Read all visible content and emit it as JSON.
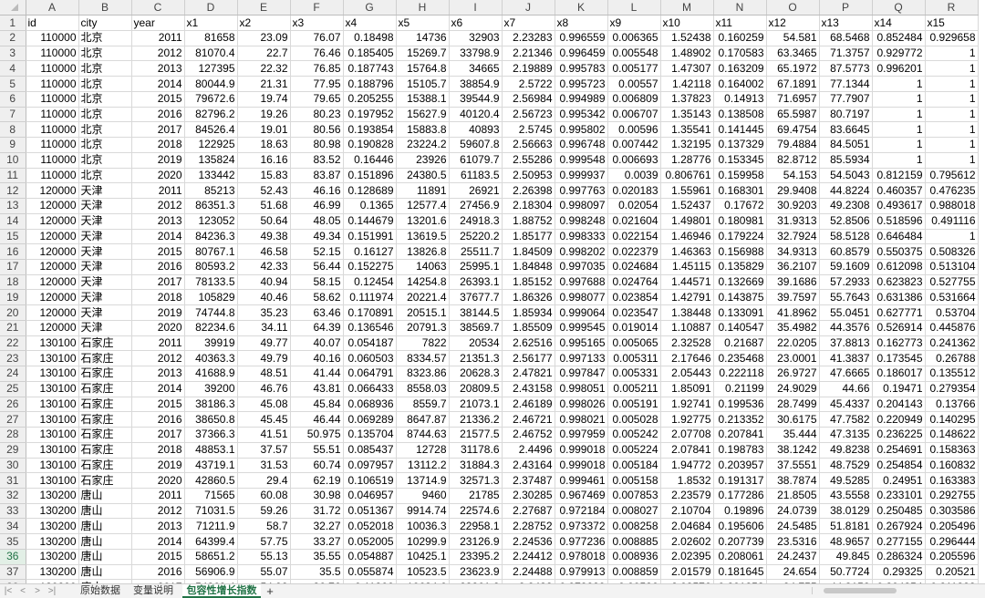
{
  "columns": [
    "A",
    "B",
    "C",
    "D",
    "E",
    "F",
    "G",
    "H",
    "I",
    "J",
    "K",
    "L",
    "M",
    "N",
    "O",
    "P",
    "Q",
    "R"
  ],
  "header_row": [
    "id",
    "city",
    "year",
    "x1",
    "x2",
    "x3",
    "x4",
    "x5",
    "x6",
    "x7",
    "x8",
    "x9",
    "x10",
    "x11",
    "x12",
    "x13",
    "x14",
    "x15"
  ],
  "rows": [
    [
      "110000",
      "北京",
      "2011",
      "81658",
      "23.09",
      "76.07",
      "0.18498",
      "14736",
      "32903",
      "2.23283",
      "0.996559",
      "0.006365",
      "1.52438",
      "0.160259",
      "54.581",
      "68.5468",
      "0.852484",
      "0.929658"
    ],
    [
      "110000",
      "北京",
      "2012",
      "81070.4",
      "22.7",
      "76.46",
      "0.185405",
      "15269.7",
      "33798.9",
      "2.21346",
      "0.996459",
      "0.005548",
      "1.48902",
      "0.170583",
      "63.3465",
      "71.3757",
      "0.929772",
      "1"
    ],
    [
      "110000",
      "北京",
      "2013",
      "127395",
      "22.32",
      "76.85",
      "0.187743",
      "15764.8",
      "34665",
      "2.19889",
      "0.995783",
      "0.005177",
      "1.47307",
      "0.163209",
      "65.1972",
      "87.5773",
      "0.996201",
      "1"
    ],
    [
      "110000",
      "北京",
      "2014",
      "80044.9",
      "21.31",
      "77.95",
      "0.188796",
      "15105.7",
      "38854.9",
      "2.5722",
      "0.995723",
      "0.00557",
      "1.42118",
      "0.164002",
      "67.1891",
      "77.1344",
      "1",
      "1"
    ],
    [
      "110000",
      "北京",
      "2015",
      "79672.6",
      "19.74",
      "79.65",
      "0.205255",
      "15388.1",
      "39544.9",
      "2.56984",
      "0.994989",
      "0.006809",
      "1.37823",
      "0.14913",
      "71.6957",
      "77.7907",
      "1",
      "1"
    ],
    [
      "110000",
      "北京",
      "2016",
      "82796.2",
      "19.26",
      "80.23",
      "0.197952",
      "15627.9",
      "40120.4",
      "2.56723",
      "0.995342",
      "0.006707",
      "1.35143",
      "0.138508",
      "65.5987",
      "80.7197",
      "1",
      "1"
    ],
    [
      "110000",
      "北京",
      "2017",
      "84526.4",
      "19.01",
      "80.56",
      "0.193854",
      "15883.8",
      "40893",
      "2.5745",
      "0.995802",
      "0.00596",
      "1.35541",
      "0.141445",
      "69.4754",
      "83.6645",
      "1",
      "1"
    ],
    [
      "110000",
      "北京",
      "2018",
      "122925",
      "18.63",
      "80.98",
      "0.190828",
      "23224.2",
      "59607.8",
      "2.56663",
      "0.996748",
      "0.007442",
      "1.32195",
      "0.137329",
      "79.4884",
      "84.5051",
      "1",
      "1"
    ],
    [
      "110000",
      "北京",
      "2019",
      "135824",
      "16.16",
      "83.52",
      "0.16446",
      "23926",
      "61079.7",
      "2.55286",
      "0.999548",
      "0.006693",
      "1.28776",
      "0.153345",
      "82.8712",
      "85.5934",
      "1",
      "1"
    ],
    [
      "110000",
      "北京",
      "2020",
      "133442",
      "15.83",
      "83.87",
      "0.151896",
      "24380.5",
      "61183.5",
      "2.50953",
      "0.999937",
      "0.0039",
      "0.806761",
      "0.159958",
      "54.153",
      "54.5043",
      "0.812159",
      "0.795612"
    ],
    [
      "120000",
      "天津",
      "2011",
      "85213",
      "52.43",
      "46.16",
      "0.128689",
      "11891",
      "26921",
      "2.26398",
      "0.997763",
      "0.020183",
      "1.55961",
      "0.168301",
      "29.9408",
      "44.8224",
      "0.460357",
      "0.476235"
    ],
    [
      "120000",
      "天津",
      "2012",
      "86351.3",
      "51.68",
      "46.99",
      "0.1365",
      "12577.4",
      "27456.9",
      "2.18304",
      "0.998097",
      "0.02054",
      "1.52437",
      "0.17672",
      "30.9203",
      "49.2308",
      "0.493617",
      "0.988018"
    ],
    [
      "120000",
      "天津",
      "2013",
      "123052",
      "50.64",
      "48.05",
      "0.144679",
      "13201.6",
      "24918.3",
      "1.88752",
      "0.998248",
      "0.021604",
      "1.49801",
      "0.180981",
      "31.9313",
      "52.8506",
      "0.518596",
      "0.491116"
    ],
    [
      "120000",
      "天津",
      "2014",
      "84236.3",
      "49.38",
      "49.34",
      "0.151991",
      "13619.5",
      "25220.2",
      "1.85177",
      "0.998333",
      "0.022154",
      "1.46946",
      "0.179224",
      "32.7924",
      "58.5128",
      "0.646484",
      "1"
    ],
    [
      "120000",
      "天津",
      "2015",
      "80767.1",
      "46.58",
      "52.15",
      "0.16127",
      "13826.8",
      "25511.7",
      "1.84509",
      "0.998202",
      "0.022379",
      "1.46363",
      "0.156988",
      "34.9313",
      "60.8579",
      "0.550375",
      "0.508326"
    ],
    [
      "120000",
      "天津",
      "2016",
      "80593.2",
      "42.33",
      "56.44",
      "0.152275",
      "14063",
      "25995.1",
      "1.84848",
      "0.997035",
      "0.024684",
      "1.45115",
      "0.135829",
      "36.2107",
      "59.1609",
      "0.612098",
      "0.513104"
    ],
    [
      "120000",
      "天津",
      "2017",
      "78133.5",
      "40.94",
      "58.15",
      "0.12454",
      "14254.8",
      "26393.1",
      "1.85152",
      "0.997688",
      "0.024764",
      "1.44571",
      "0.132669",
      "39.1686",
      "57.2933",
      "0.623823",
      "0.527755"
    ],
    [
      "120000",
      "天津",
      "2018",
      "105829",
      "40.46",
      "58.62",
      "0.111974",
      "20221.4",
      "37677.7",
      "1.86326",
      "0.998077",
      "0.023854",
      "1.42791",
      "0.143875",
      "39.7597",
      "55.7643",
      "0.631386",
      "0.531664"
    ],
    [
      "120000",
      "天津",
      "2019",
      "74744.8",
      "35.23",
      "63.46",
      "0.170891",
      "20515.1",
      "38144.5",
      "1.85934",
      "0.999064",
      "0.023547",
      "1.38448",
      "0.133091",
      "41.8962",
      "55.0451",
      "0.627771",
      "0.53704"
    ],
    [
      "120000",
      "天津",
      "2020",
      "82234.6",
      "34.11",
      "64.39",
      "0.136546",
      "20791.3",
      "38569.7",
      "1.85509",
      "0.999545",
      "0.019014",
      "1.10887",
      "0.140547",
      "35.4982",
      "44.3576",
      "0.526914",
      "0.445876"
    ],
    [
      "130100",
      "石家庄",
      "2011",
      "39919",
      "49.77",
      "40.07",
      "0.054187",
      "7822",
      "20534",
      "2.62516",
      "0.995165",
      "0.005065",
      "2.32528",
      "0.21687",
      "22.0205",
      "37.8813",
      "0.162773",
      "0.241362"
    ],
    [
      "130100",
      "石家庄",
      "2012",
      "40363.3",
      "49.79",
      "40.16",
      "0.060503",
      "8334.57",
      "21351.3",
      "2.56177",
      "0.997133",
      "0.005311",
      "2.17646",
      "0.235468",
      "23.0001",
      "41.3837",
      "0.173545",
      "0.26788"
    ],
    [
      "130100",
      "石家庄",
      "2013",
      "41688.9",
      "48.51",
      "41.44",
      "0.064791",
      "8323.86",
      "20628.3",
      "2.47821",
      "0.997847",
      "0.005331",
      "2.05443",
      "0.222118",
      "26.9727",
      "47.6665",
      "0.186017",
      "0.135512"
    ],
    [
      "130100",
      "石家庄",
      "2014",
      "39200",
      "46.76",
      "43.81",
      "0.066433",
      "8558.03",
      "20809.5",
      "2.43158",
      "0.998051",
      "0.005211",
      "1.85091",
      "0.21199",
      "24.9029",
      "44.66",
      "0.19471",
      "0.279354"
    ],
    [
      "130100",
      "石家庄",
      "2015",
      "38186.3",
      "45.08",
      "45.84",
      "0.068936",
      "8559.7",
      "21073.1",
      "2.46189",
      "0.998026",
      "0.005191",
      "1.92741",
      "0.199536",
      "28.7499",
      "45.4337",
      "0.204143",
      "0.13766"
    ],
    [
      "130100",
      "石家庄",
      "2016",
      "38650.8",
      "45.45",
      "46.44",
      "0.069289",
      "8647.87",
      "21336.2",
      "2.46721",
      "0.998021",
      "0.005028",
      "1.92775",
      "0.213352",
      "30.6175",
      "47.7582",
      "0.220949",
      "0.140295"
    ],
    [
      "130100",
      "石家庄",
      "2017",
      "37366.3",
      "41.51",
      "50.975",
      "0.135704",
      "8744.63",
      "21577.5",
      "2.46752",
      "0.997959",
      "0.005242",
      "2.07708",
      "0.207841",
      "35.444",
      "47.3135",
      "0.236225",
      "0.148622"
    ],
    [
      "130100",
      "石家庄",
      "2018",
      "48853.1",
      "37.57",
      "55.51",
      "0.085437",
      "12728",
      "31178.6",
      "2.4496",
      "0.999018",
      "0.005224",
      "2.07841",
      "0.198783",
      "38.1242",
      "49.8238",
      "0.254691",
      "0.158363"
    ],
    [
      "130100",
      "石家庄",
      "2019",
      "43719.1",
      "31.53",
      "60.74",
      "0.097957",
      "13112.2",
      "31884.3",
      "2.43164",
      "0.999018",
      "0.005184",
      "1.94772",
      "0.203957",
      "37.5551",
      "48.7529",
      "0.254854",
      "0.160832"
    ],
    [
      "130100",
      "石家庄",
      "2020",
      "42860.5",
      "29.4",
      "62.19",
      "0.106519",
      "13714.9",
      "32571.3",
      "2.37487",
      "0.999461",
      "0.005158",
      "1.8532",
      "0.191317",
      "38.7874",
      "49.5285",
      "0.24951",
      "0.163383"
    ],
    [
      "130200",
      "唐山",
      "2011",
      "71565",
      "60.08",
      "30.98",
      "0.046957",
      "9460",
      "21785",
      "2.30285",
      "0.967469",
      "0.007853",
      "2.23579",
      "0.177286",
      "21.8505",
      "43.5558",
      "0.233101",
      "0.292755"
    ],
    [
      "130200",
      "唐山",
      "2012",
      "71031.5",
      "59.26",
      "31.72",
      "0.051367",
      "9914.74",
      "22574.6",
      "2.27687",
      "0.972184",
      "0.008027",
      "2.10704",
      "0.19896",
      "24.0739",
      "38.0129",
      "0.250485",
      "0.303586"
    ],
    [
      "130200",
      "唐山",
      "2013",
      "71211.9",
      "58.7",
      "32.27",
      "0.052018",
      "10036.3",
      "22958.1",
      "2.28752",
      "0.973372",
      "0.008258",
      "2.04684",
      "0.195606",
      "24.5485",
      "51.8181",
      "0.267924",
      "0.205496"
    ],
    [
      "130200",
      "唐山",
      "2014",
      "64399.4",
      "57.75",
      "33.27",
      "0.052005",
      "10299.9",
      "23126.9",
      "2.24536",
      "0.977236",
      "0.008885",
      "2.02602",
      "0.207739",
      "23.5316",
      "48.9657",
      "0.277155",
      "0.296444"
    ],
    [
      "130200",
      "唐山",
      "2015",
      "58651.2",
      "55.13",
      "35.55",
      "0.054887",
      "10425.1",
      "23395.2",
      "2.24412",
      "0.978018",
      "0.008936",
      "2.02395",
      "0.208061",
      "24.2437",
      "49.845",
      "0.286324",
      "0.205596"
    ],
    [
      "130200",
      "唐山",
      "2016",
      "56906.9",
      "55.07",
      "35.5",
      "0.055874",
      "10523.5",
      "23623.9",
      "2.24488",
      "0.979913",
      "0.008859",
      "2.01579",
      "0.181645",
      "24.654",
      "50.7724",
      "0.29325",
      "0.20521"
    ],
    [
      "130200",
      "唐山",
      "2017",
      "54369.4",
      "54.98",
      "36.76",
      "0.11866",
      "10634.6",
      "23861.8",
      "2.2438",
      "0.978289",
      "0.00586",
      "2.03576",
      "0.201853",
      "24.755",
      "44.3152",
      "0.304354",
      "0.211328"
    ],
    [
      "130200",
      "唐山",
      "2018",
      "77023.7",
      "54.89",
      "38.02",
      "0.062176",
      "15479.3",
      "34511.8",
      "2.22955",
      "0.981222",
      "0.004753",
      "2.02902",
      "0.193778",
      "29.9169",
      "47.4657",
      "0.31249",
      "0.222006"
    ],
    [
      "130200",
      "唐山",
      "2019",
      "71681.3",
      "52.44",
      "39.85",
      "0.06754",
      "15747.6",
      "35260.4",
      "2.20708",
      "0.982559",
      "0.00516",
      "2.01984",
      "0.195642",
      "32.1058",
      "49.1151",
      "0.324147",
      "0.232226"
    ]
  ],
  "selected_row": 36,
  "sheet_tabs": [
    "原始数据",
    "变量说明",
    "包容性增长指数"
  ],
  "active_tab": "包容性增长指数",
  "nav_icons": [
    "first-sheet-icon",
    "prev-sheet-icon",
    "next-sheet-icon",
    "last-sheet-icon"
  ],
  "nav_glyphs": [
    "|<",
    "<",
    ">",
    ">|"
  ],
  "add_tab_glyph": "+",
  "accent_color": "#217346"
}
